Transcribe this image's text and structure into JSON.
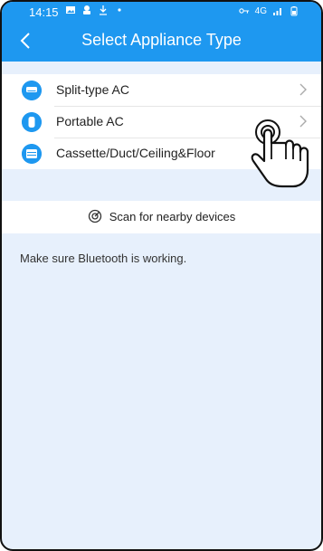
{
  "statusbar": {
    "time": "14:15",
    "right_text": "4G"
  },
  "header": {
    "title": "Select Appliance Type"
  },
  "list": {
    "items": [
      {
        "label": "Split-type AC",
        "icon": "split-ac-icon"
      },
      {
        "label": "Portable AC",
        "icon": "portable-ac-icon"
      },
      {
        "label": "Cassette/Duct/Ceiling&Floor",
        "icon": "cassette-ac-icon"
      }
    ]
  },
  "scan": {
    "label": "Scan for nearby devices"
  },
  "hint": {
    "text": "Make sure Bluetooth is working."
  },
  "colors": {
    "primary": "#1e98f0",
    "background": "#e7f0fc"
  }
}
